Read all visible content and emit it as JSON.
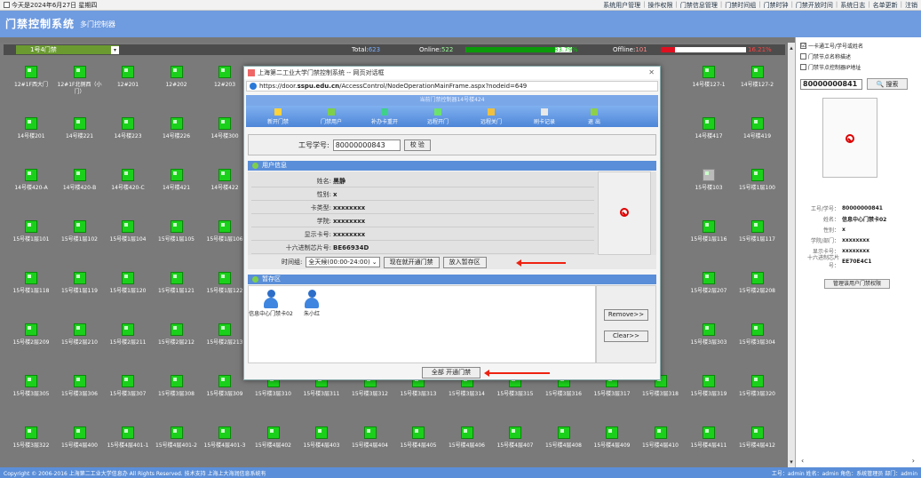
{
  "top": {
    "date": "今天是2024年6月27日 星期四",
    "nav": [
      "系统用户管理",
      "操作权限",
      "门禁信息管理",
      "门禁时间组",
      "门禁时钟",
      "门禁开放时间",
      "系统日志",
      "名单更新",
      "注销"
    ]
  },
  "header": {
    "title": "门禁控制系统",
    "subtitle": "多门控制器"
  },
  "gridbar": {
    "selected": "1号4门禁",
    "total_label": "Total:",
    "total_value": "623",
    "online_label": "Online:",
    "online_value": "522",
    "online_pct": "83.79%",
    "online_ratio": 0.8379,
    "offline_label": "Offline:",
    "offline_value": "101",
    "offline_pct": "16.21%",
    "offline_ratio": 0.1621
  },
  "nodes": [
    [
      "12#1F西大门",
      "12#1F北侧西（小门）",
      "12#201",
      "12#202",
      "12#203",
      "",
      "",
      "",
      "",
      "",
      "",
      "",
      "",
      "",
      "14号楼127-1",
      "14号楼127-2"
    ],
    [
      "14号楼201",
      "14号楼221",
      "14号楼223",
      "14号楼226",
      "14号楼300",
      "",
      "",
      "",
      "",
      "",
      "",
      "",
      "",
      "",
      "14号楼417",
      "14号楼419"
    ],
    [
      "14号楼420-A",
      "14号楼420-B",
      "14号楼420-C",
      "14号楼421",
      "14号楼422",
      "",
      "",
      "",
      "",
      "",
      "",
      "",
      "",
      "",
      "15号楼103",
      "15号楼1层100"
    ],
    [
      "15号楼1层101",
      "15号楼1层102",
      "15号楼1层104",
      "15号楼1层105",
      "15号楼1层106",
      "",
      "",
      "",
      "",
      "",
      "",
      "",
      "",
      "",
      "15号楼1层116",
      "15号楼1层117"
    ],
    [
      "15号楼1层118",
      "15号楼1层119",
      "15号楼1层120",
      "15号楼1层121",
      "15号楼1层122",
      "",
      "",
      "",
      "",
      "",
      "",
      "",
      "",
      "",
      "15号楼2层207",
      "15号楼2层208"
    ],
    [
      "15号楼2层209",
      "15号楼2层210",
      "15号楼2层211",
      "15号楼2层212",
      "15号楼2层213",
      "",
      "",
      "",
      "",
      "",
      "",
      "",
      "",
      "",
      "15号楼3层303",
      "15号楼3层304"
    ],
    [
      "15号楼3层305",
      "15号楼3层306",
      "15号楼3层307",
      "15号楼3层308",
      "15号楼3层309",
      "15号楼3层310",
      "15号楼3层311",
      "15号楼3层312",
      "15号楼3层313",
      "15号楼3层314",
      "15号楼3层315",
      "15号楼3层316",
      "15号楼3层317",
      "15号楼3层318",
      "15号楼3层319",
      "15号楼3层320"
    ],
    [
      "15号楼3层322",
      "15号楼4层400",
      "15号楼4层401-1",
      "15号楼4层401-2",
      "15号楼4层401-3",
      "15号楼4层402",
      "15号楼4层403",
      "15号楼4层404",
      "15号楼4层405",
      "15号楼4层406",
      "15号楼4层407",
      "15号楼4层408",
      "15号楼4层409",
      "15号楼4层410",
      "15号楼4层411",
      "15号楼4层412"
    ]
  ],
  "rpanel": {
    "checks": [
      {
        "label": "一卡通工号/学号或姓名",
        "checked": "☑"
      },
      {
        "label": "门禁节点名称描述",
        "checked": ""
      },
      {
        "label": "门禁节点控制器IP地址",
        "checked": ""
      }
    ],
    "search_value": "80000000841",
    "search_btn": "搜索",
    "info": [
      {
        "k": "工号/学号：",
        "v": "80000000841"
      },
      {
        "k": "姓名：",
        "v": "信息中心门禁卡02"
      },
      {
        "k": "性别：",
        "v": "x"
      },
      {
        "k": "学院/部门：",
        "v": "xxxxxxxx"
      },
      {
        "k": "显示卡号：",
        "v": "xxxxxxxx"
      },
      {
        "k": "十六进制芯片号：",
        "v": "EE70E4C1"
      }
    ],
    "perm_btn": "管理该用户门禁权限"
  },
  "footer": {
    "left": "Copyright © 2006-2016  上海第二工业大学信息办 All Rights Reserved.  技术支持 上海上大海润信息系统有",
    "right": "工号：admin  姓名：admin  角色：系统管理员  部门：admin"
  },
  "dialog": {
    "title": "上海第二工业大学门禁控制系统 -- 网页对话框",
    "url_prefix": "https://door.",
    "url_bold": "sspu.edu.cn",
    "url_suffix": "/AccessControl/NodeOperationMainFrame.aspx?nodeid=649",
    "band": "当前门禁控制器14号楼424",
    "tools": [
      "新开门禁",
      "门禁用户",
      "补办卡重开",
      "远程开门",
      "远程关门",
      "刷卡记录",
      "退 出"
    ],
    "id_label": "工号学号:",
    "id_value": "80000000843",
    "verify_btn": "校 验",
    "user_head": "用户信息",
    "user": [
      {
        "k": "姓名:",
        "v": "黑静"
      },
      {
        "k": "性别:",
        "v": "x"
      },
      {
        "k": "卡类型:",
        "v": "xxxxxxxx"
      },
      {
        "k": "学院:",
        "v": "xxxxxxxx"
      },
      {
        "k": "显示卡号:",
        "v": "xxxxxxxx"
      },
      {
        "k": "十六进制芯片号:",
        "v": "BE66934D"
      }
    ],
    "time_label": "时间组:",
    "time_value": "全天候(00:00-24:00)",
    "open_now_btn": "现在就开通门禁",
    "temp_add_btn": "放入暂存区",
    "temp_head": "暂存区",
    "people": [
      "信息中心门禁卡02",
      "朱小红"
    ],
    "remove_btn": "Remove>>",
    "clear_btn": "Clear>>",
    "all_btn": "全部 开通门禁"
  },
  "colors": {
    "accent": "#5a8ed8",
    "online": "#0a9a0a",
    "offline": "#e01020",
    "node": "#1bd01b"
  }
}
